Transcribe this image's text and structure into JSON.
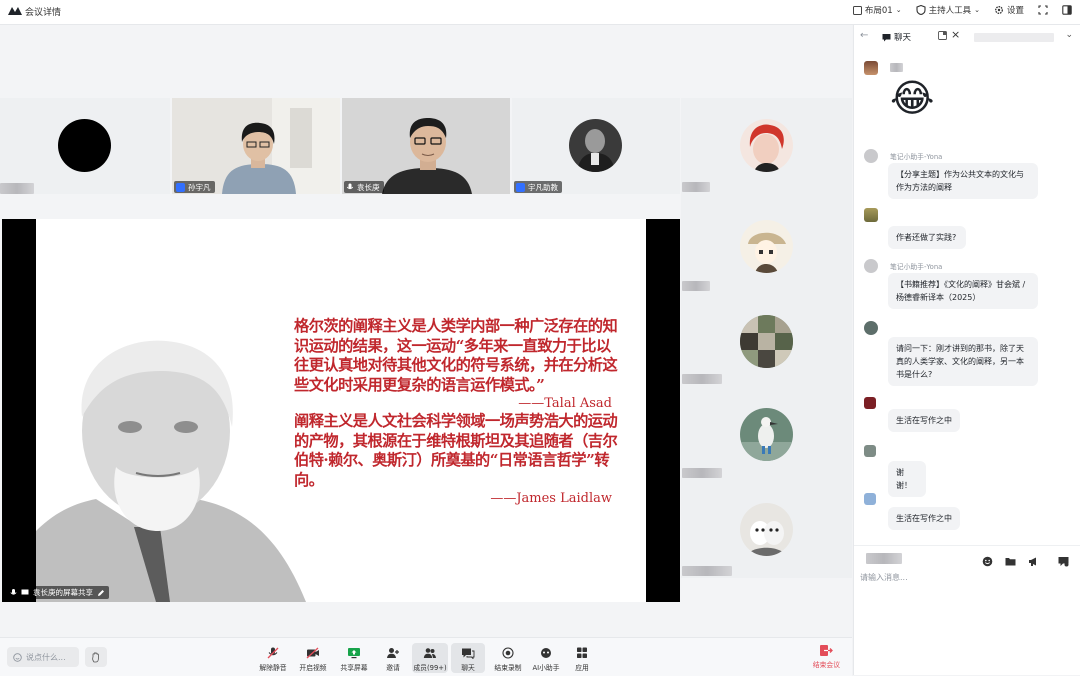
{
  "window": {
    "title": "会议详情"
  },
  "header": {
    "layout_label": "布局01",
    "host_tools_label": "主持人工具",
    "settings_label": "设置"
  },
  "participants": [
    {
      "name": "孙宇凡"
    },
    {
      "name": "袁长庚"
    },
    {
      "name": "宇凡助教"
    }
  ],
  "share": {
    "sharer_label": "袁长庚的屏幕共享",
    "quote1": "格尔茨的阐释主义是人类学内部一种广泛存在的知识运动的结果，这一运动“多年来一直致力于比以往更认真地对待其他文化的符号系统，并在分析这些文化时采用更复杂的语言运作模式。”",
    "attr1": "——Talal Asad",
    "quote2": "阐释主义是人文社会科学领域一场声势浩大的运动的产物，其根源在于维特根斯坦及其追随者（吉尔伯特·赖尔、奥斯汀）所奠基的“日常语言哲学”转向。",
    "attr2": "——James Laidlaw"
  },
  "toolbar": {
    "say_placeholder": "说点什么...",
    "buttons": [
      {
        "label": "解除静音"
      },
      {
        "label": "开启视频"
      },
      {
        "label": "共享屏幕"
      },
      {
        "label": "邀请"
      },
      {
        "label": "成员(99+)"
      },
      {
        "label": "聊天"
      },
      {
        "label": "结束录制"
      },
      {
        "label": "AI小助手"
      },
      {
        "label": "应用"
      }
    ],
    "leave_label": "结束会议"
  },
  "chat": {
    "tab_label": "聊天",
    "messages": [
      {
        "sender": "",
        "emoji": "😂"
      },
      {
        "sender": "笔记小助手-Yona",
        "text": "【分享主题】作为公共文本的文化与作为方法的阐释"
      },
      {
        "sender": "",
        "text": "作者还做了实践?"
      },
      {
        "sender": "笔记小助手-Yona",
        "text": "【书籍推荐】《文化的阐释》甘会斌 / 杨德睿新译本（2025）"
      },
      {
        "sender": "",
        "text": "请问一下：刚才讲到的那书，除了天真的人类学家、文化的阐释，另一本书是什么?"
      },
      {
        "sender": "",
        "text": "生活在写作之中"
      },
      {
        "sender": "",
        "text": "谢谢！"
      },
      {
        "sender": "",
        "text": "生活在写作之中"
      }
    ],
    "input_placeholder": "请输入消息..."
  },
  "colors": {
    "accent": "#3370ff",
    "quote_red": "#c0272d",
    "leave_red": "#e34d59"
  }
}
